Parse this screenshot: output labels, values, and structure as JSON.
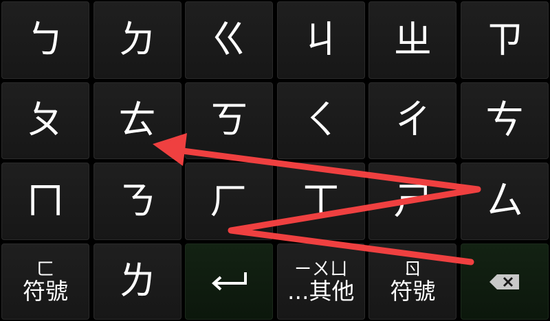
{
  "keyboard": {
    "rows": [
      [
        "ㄅ",
        "ㄉ",
        "ㄍ",
        "ㄐ",
        "ㄓ",
        "ㄗ"
      ],
      [
        "ㄆ",
        "ㄊ",
        "ㄎ",
        "ㄑ",
        "ㄔ",
        "ㄘ"
      ],
      [
        "ㄇ",
        "ㄋ",
        "ㄏ",
        "ㄒ",
        "ㄕ",
        "ㄙ"
      ]
    ],
    "bottom": {
      "symbols_left_top": "ㄈ",
      "symbols_left_label": "符號",
      "key_l": "ㄌ",
      "enter_icon": "enter-arrow-icon",
      "other_top": "ㄧㄨㄩ",
      "other_label": "...其他",
      "symbols_right_top": "ㄖ",
      "symbols_right_label": "符號",
      "backspace_icon": "backspace-icon"
    }
  },
  "colors": {
    "key_bg": "#1f1f1f",
    "key_text": "#ffffff",
    "action_key_bg": "#132213",
    "swipe_trail": "#ef4040"
  }
}
